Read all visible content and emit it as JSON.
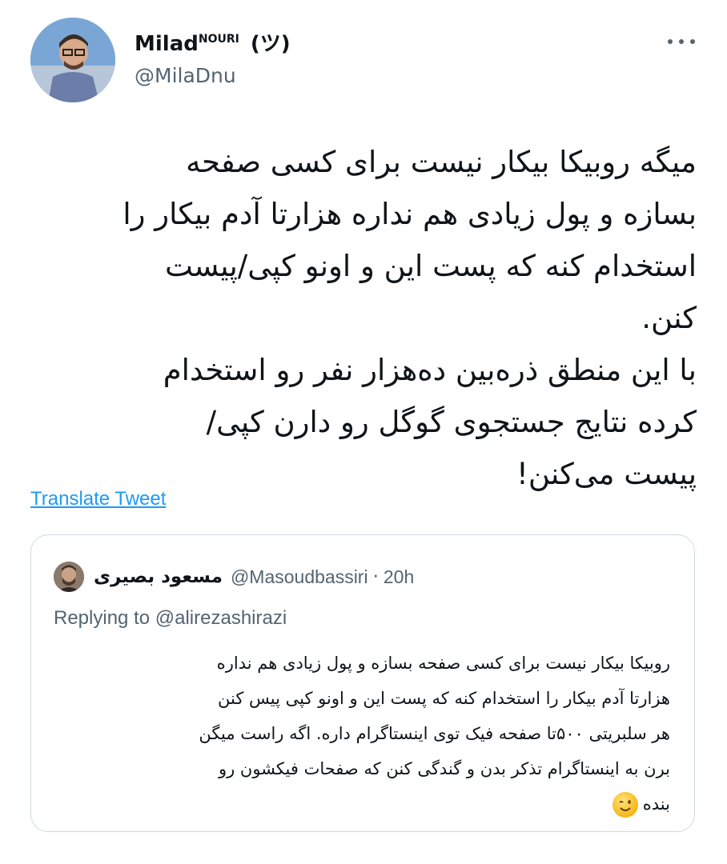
{
  "author": {
    "name": "Milad",
    "name_sup": "NOURI",
    "name_suffix": "(ツ)",
    "handle": "@MilaDnu"
  },
  "tweet": {
    "lines": [
      "میگه روبیکا بیکار نیست برای کسی صفحه",
      "بسازه و پول زیادی هم نداره هزارتا آدم بیکار را",
      "استخدام کنه که پست این و اونو کپی/پیست",
      "کنن.",
      "با این منطق ذره‌بین ده‌هزار نفر رو استخدام",
      "کرده نتایج جستجوی گوگل رو دارن کپی/",
      "پیست می‌کنن!"
    ]
  },
  "translate_label": "Translate Tweet",
  "quote": {
    "name": "مسعود بصیری",
    "handle": "@Masoudbassiri",
    "separator": "·",
    "time": "20h",
    "replying_prefix": "Replying to",
    "replying_handle": "@alirezashirazi",
    "lines": [
      "روبیکا بیکار نیست برای کسی صفحه بسازه و پول زیادی هم نداره",
      "هزارتا آدم بیکار را استخدام کنه که پست این و اونو کپی پیس کنن",
      "هر سلبریتی ۵۰۰تا صفحه فیک توی اینستاگرام داره. اگه راست میگن",
      "برن به اینستاگرام تذکر بدن و گندگی کنن که صفحات فیکشون رو",
      "بنده"
    ],
    "emoji": "winking-face-emoji"
  },
  "colors": {
    "link": "#1d9bf0",
    "secondary_text": "#536471",
    "border": "#cfd9de"
  }
}
